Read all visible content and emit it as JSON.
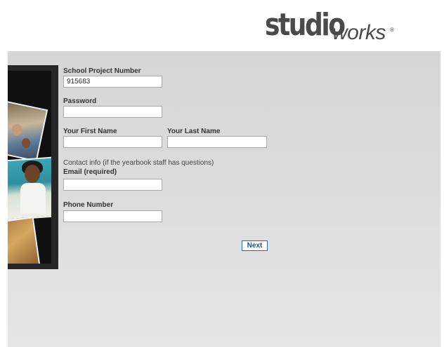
{
  "brand": {
    "logo_bold": "studio",
    "logo_light": "works",
    "logo_mark": "®"
  },
  "form": {
    "project_number": {
      "label": "School Project Number",
      "value": "915683"
    },
    "password": {
      "label": "Password",
      "value": ""
    },
    "first_name": {
      "label": "Your First Name",
      "value": ""
    },
    "last_name": {
      "label": "Your Last Name",
      "value": ""
    },
    "contact_note": "Contact info (if the yearbook staff has questions)",
    "email": {
      "label": "Email (required)",
      "value": ""
    },
    "phone": {
      "label": "Phone Number",
      "value": ""
    },
    "next_label": "Next"
  }
}
